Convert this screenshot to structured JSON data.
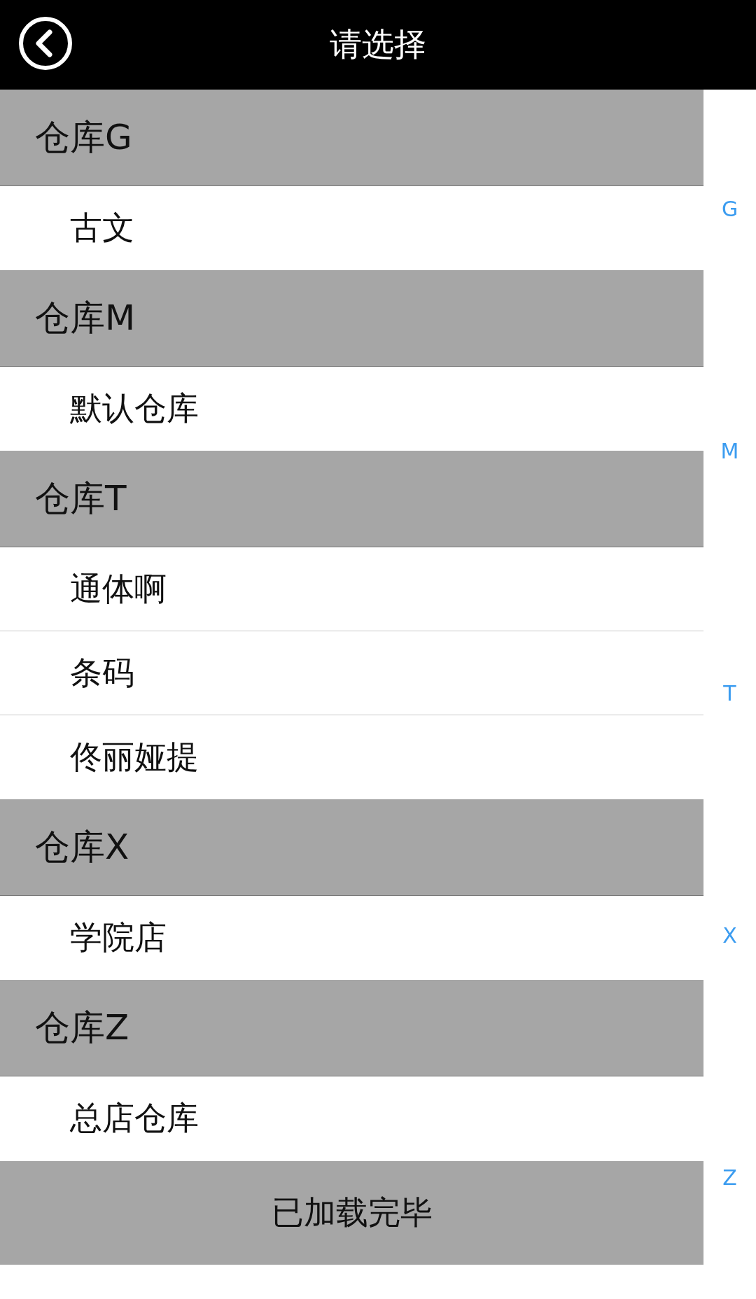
{
  "header": {
    "title": "请选择"
  },
  "sections": [
    {
      "title": "仓库G",
      "items": [
        "古文"
      ]
    },
    {
      "title": "仓库M",
      "items": [
        "默认仓库"
      ]
    },
    {
      "title": "仓库T",
      "items": [
        "通体啊",
        "条码",
        "佟丽娅提"
      ]
    },
    {
      "title": "仓库X",
      "items": [
        "学院店"
      ]
    },
    {
      "title": "仓库Z",
      "items": [
        "总店仓库"
      ]
    }
  ],
  "footer": "已加载完毕",
  "index": [
    "G",
    "M",
    "T",
    "X",
    "Z"
  ]
}
